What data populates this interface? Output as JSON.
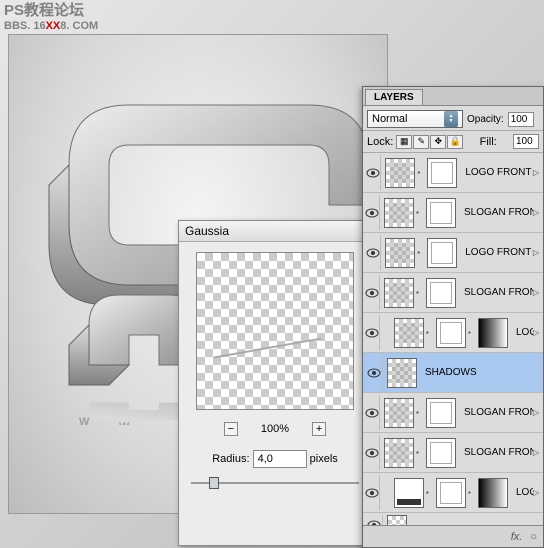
{
  "watermark": {
    "line1": "PS教程论坛",
    "line2_pre": "BBS. 16",
    "line2_xx": "XX",
    "line2_post": "8. COM"
  },
  "gaussian": {
    "title": "Gaussia",
    "zoom_minus": "−",
    "zoom_plus": "+",
    "zoom_pct": "100%",
    "radius_label": "Radius:",
    "radius_value": "4,0",
    "radius_unit": "pixels"
  },
  "layers_panel": {
    "tab": "LAYERS",
    "blend_mode": "Normal",
    "opacity_label": "Opacity:",
    "opacity_value": "100",
    "lock_label": "Lock:",
    "fill_label": "Fill:",
    "fill_value": "100",
    "lock_icons": [
      "checker-icon",
      "brush-icon",
      "move-icon",
      "lock-icon"
    ],
    "layers": [
      {
        "name": "LOGO FRONT A",
        "selected": false,
        "thumbs": [
          "content",
          "mask"
        ],
        "disclosure": true
      },
      {
        "name": "SLOGAN FRONT A",
        "selected": false,
        "thumbs": [
          "content",
          "mask"
        ],
        "disclosure": true
      },
      {
        "name": "LOGO FRONT B",
        "selected": false,
        "thumbs": [
          "content",
          "mask"
        ],
        "disclosure": true
      },
      {
        "name": "SLOGAN FRONT B",
        "selected": false,
        "thumbs": [
          "content",
          "mask"
        ],
        "disclosure": true
      },
      {
        "name": "LOGO FRONT A_R",
        "selected": false,
        "thumbs": [
          "content",
          "mask",
          "grad"
        ],
        "disclosure": true,
        "indent": true
      },
      {
        "name": "SHADOWS",
        "selected": true,
        "thumbs": [
          "content"
        ],
        "disclosure": false
      },
      {
        "name": "SLOGAN FRONT A_R",
        "selected": false,
        "thumbs": [
          "content",
          "mask"
        ],
        "disclosure": true
      },
      {
        "name": "SLOGAN FRONT B_R",
        "selected": false,
        "thumbs": [
          "content",
          "mask"
        ],
        "disclosure": true
      },
      {
        "name": "LOGO FRONT B_R",
        "selected": false,
        "thumbs": [
          "dark",
          "mask",
          "grad"
        ],
        "disclosure": true,
        "indent": true
      }
    ],
    "footer_fx": "fx."
  }
}
